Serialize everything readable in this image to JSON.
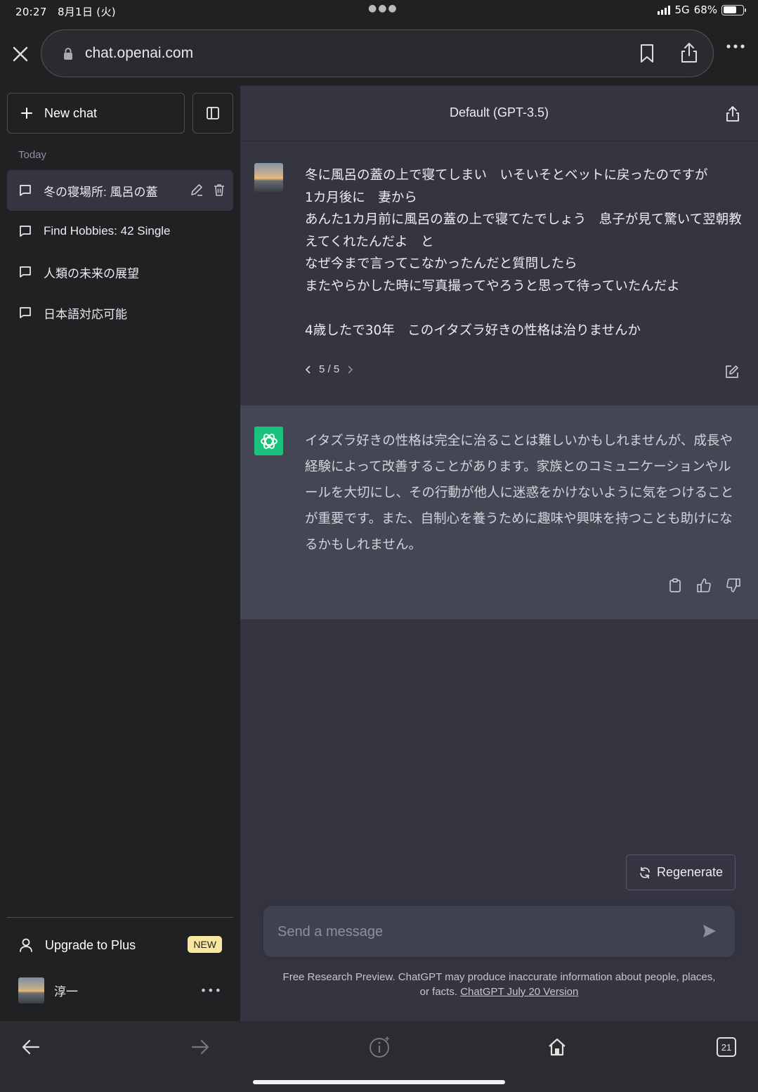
{
  "status": {
    "time": "20:27",
    "date": "8月1日 (火)",
    "network": "5G",
    "battery": "68%",
    "battery_level": 0.68
  },
  "browser": {
    "url": "chat.openai.com"
  },
  "sidebar": {
    "new_chat_label": "New chat",
    "section_label": "Today",
    "items": [
      {
        "label": "冬の寝場所: 風呂の蓋"
      },
      {
        "label": "Find Hobbies: 42 Single"
      },
      {
        "label": "人類の未来の展望"
      },
      {
        "label": "日本語対応可能"
      }
    ],
    "upgrade_label": "Upgrade to Plus",
    "new_badge": "NEW",
    "user_name": "淳一"
  },
  "main": {
    "model_title": "Default (GPT-3.5)",
    "user_message": "冬に風呂の蓋の上で寝てしまい　いそいそとベットに戻ったのですが\n1カ月後に　妻から\nあんた1カ月前に風呂の蓋の上で寝てたでしょう　息子が見て驚いて翌朝教えてくれたんだよ　と\nなぜ今まで言ってこなかったんだと質問したら\nまたやらかした時に写真撮ってやろうと思って待っていたんだよ\n\n4歳したで30年　このイタズラ好きの性格は治りませんか",
    "pager": "5 / 5",
    "assistant_message": "イタズラ好きの性格は完全に治ることは難しいかもしれませんが、成長や経験によって改善することがあります。家族とのコミュニケーションやルールを大切にし、その行動が他人に迷惑をかけないように気をつけることが重要です。また、自制心を養うために趣味や興味を持つことも助けになるかもしれません。",
    "regenerate_label": "Regenerate",
    "input_placeholder": "Send a message",
    "disclaimer_text": "Free Research Preview. ChatGPT may produce inaccurate information about people, places, or facts. ",
    "disclaimer_link": "ChatGPT July 20 Version"
  },
  "toolbar": {
    "tab_count": "21"
  },
  "colors": {
    "sidebar_bg": "#202123",
    "main_bg": "#343541",
    "assistant_bg": "#444654",
    "accent": "#19c37d",
    "badge": "#fae69e"
  }
}
